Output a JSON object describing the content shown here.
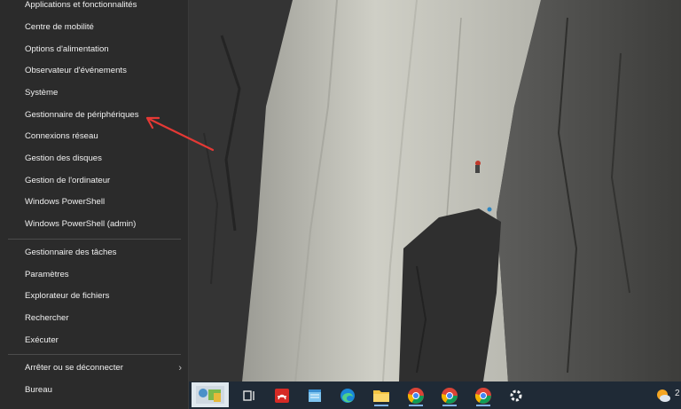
{
  "menu": {
    "group1": [
      {
        "label": "Applications et fonctionnalités"
      },
      {
        "label": "Centre de mobilité"
      },
      {
        "label": "Options d'alimentation"
      },
      {
        "label": "Observateur d'événements"
      },
      {
        "label": "Système"
      },
      {
        "label": "Gestionnaire de périphériques"
      },
      {
        "label": "Connexions réseau"
      },
      {
        "label": "Gestion des disques"
      },
      {
        "label": "Gestion de l'ordinateur"
      },
      {
        "label": "Windows PowerShell"
      },
      {
        "label": "Windows PowerShell (admin)"
      }
    ],
    "group2": [
      {
        "label": "Gestionnaire des tâches"
      },
      {
        "label": "Paramètres"
      },
      {
        "label": "Explorateur de fichiers"
      },
      {
        "label": "Rechercher"
      },
      {
        "label": "Exécuter"
      }
    ],
    "group3": [
      {
        "label": "Arrêter ou se déconnecter",
        "submenu_chevron": "›"
      },
      {
        "label": "Bureau"
      }
    ]
  },
  "taskbar": {
    "icons": [
      "start-thumbnail-icon",
      "task-view-icon",
      "acrobat-icon",
      "notepad-icon",
      "edge-icon",
      "file-explorer-icon",
      "chrome-icon",
      "chrome-icon",
      "chrome-icon",
      "settings-icon"
    ],
    "tray_icon": "weather-icon",
    "tray_text": "2"
  },
  "colors": {
    "menu_bg": "#2b2b2b",
    "menu_text": "#f0f0f0",
    "annotation": "#e53935",
    "taskbar_bg": "#1f2a36"
  }
}
